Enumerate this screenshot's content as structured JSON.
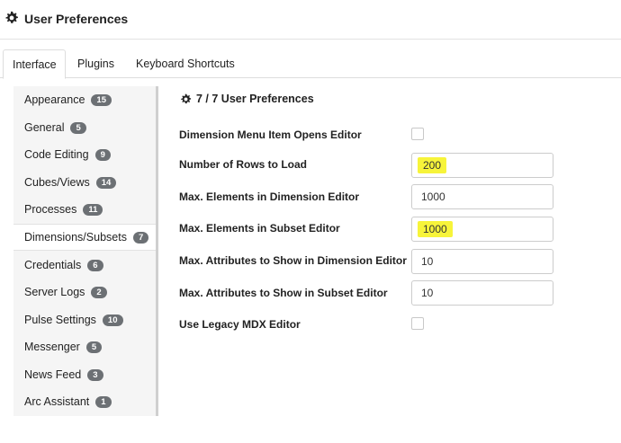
{
  "header": {
    "title": "User Preferences",
    "icon": "gear-icon"
  },
  "tabs": [
    {
      "label": "Interface",
      "active": true
    },
    {
      "label": "Plugins",
      "active": false
    },
    {
      "label": "Keyboard Shortcuts",
      "active": false
    }
  ],
  "sidebar": {
    "items": [
      {
        "label": "Appearance",
        "count": "15"
      },
      {
        "label": "General",
        "count": "5"
      },
      {
        "label": "Code Editing",
        "count": "9"
      },
      {
        "label": "Cubes/Views",
        "count": "14"
      },
      {
        "label": "Processes",
        "count": "11"
      },
      {
        "label": "Dimensions/Subsets",
        "count": "7",
        "active": true
      },
      {
        "label": "Credentials",
        "count": "6"
      },
      {
        "label": "Server Logs",
        "count": "2"
      },
      {
        "label": "Pulse Settings",
        "count": "10"
      },
      {
        "label": "Messenger",
        "count": "5"
      },
      {
        "label": "News Feed",
        "count": "3"
      },
      {
        "label": "Arc Assistant",
        "count": "1"
      }
    ]
  },
  "content": {
    "title": "7 / 7 User Preferences",
    "settings": [
      {
        "label": "Dimension Menu Item Opens Editor",
        "type": "checkbox",
        "checked": false
      },
      {
        "label": "Number of Rows to Load",
        "type": "input",
        "value": "200",
        "highlight": true
      },
      {
        "label": "Max. Elements in Dimension Editor",
        "type": "input",
        "value": "1000"
      },
      {
        "label": "Max. Elements in Subset Editor",
        "type": "input",
        "value": "1000",
        "highlight": true
      },
      {
        "label": "Max. Attributes to Show in Dimension Editor",
        "type": "input",
        "value": "10"
      },
      {
        "label": "Max. Attributes to Show in Subset Editor",
        "type": "input",
        "value": "10"
      },
      {
        "label": "Use Legacy MDX Editor",
        "type": "checkbox",
        "checked": false
      }
    ]
  },
  "colors": {
    "highlight": "#f7f43a",
    "badge": "#6c7074",
    "sidebar_bg": "#f5f5f5"
  }
}
